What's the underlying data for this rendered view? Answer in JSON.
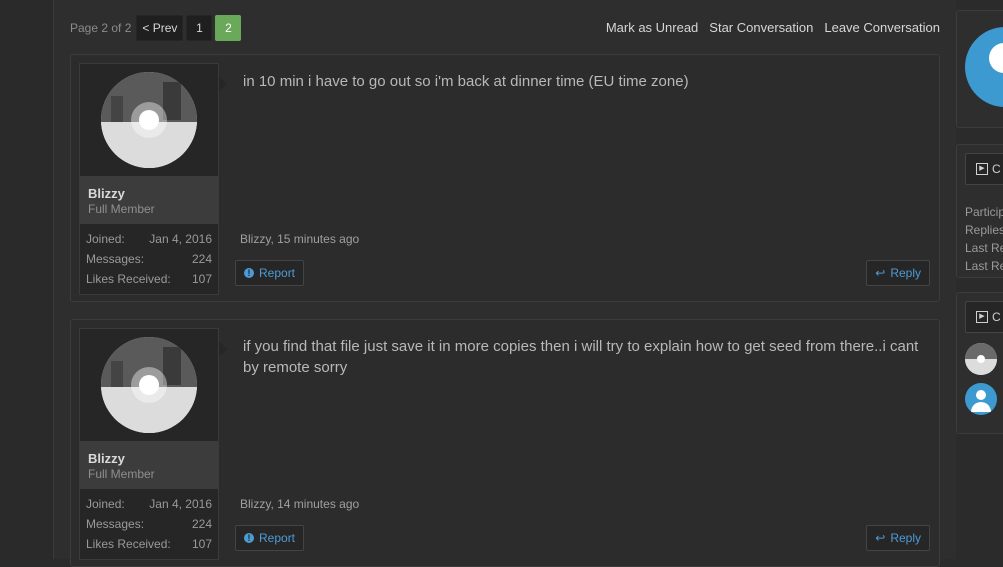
{
  "pagination": {
    "label": "Page 2 of 2",
    "prev": "< Prev",
    "pages": [
      "1",
      "2"
    ],
    "current": "2"
  },
  "conversation_actions": {
    "mark_unread": "Mark as Unread",
    "star": "Star Conversation",
    "leave": "Leave Conversation"
  },
  "posts": [
    {
      "author": "Blizzy",
      "user_title": "Full Member",
      "stats": [
        {
          "label": "Joined:",
          "value": "Jan 4, 2016"
        },
        {
          "label": "Messages:",
          "value": "224"
        },
        {
          "label": "Likes Received:",
          "value": "107"
        }
      ],
      "message": "in 10 min i have to go out so i'm back at dinner time (EU time zone)",
      "meta": "Blizzy, 15 minutes ago",
      "report_label": "Report",
      "reply_label": "Reply"
    },
    {
      "author": "Blizzy",
      "user_title": "Full Member",
      "stats": [
        {
          "label": "Joined:",
          "value": "Jan 4, 2016"
        },
        {
          "label": "Messages:",
          "value": "224"
        },
        {
          "label": "Likes Received:",
          "value": "107"
        }
      ],
      "message": "if you find that file just save it in more copies then i will try to explain how to get seed from there..i cant by remote sorry",
      "meta": "Blizzy, 14 minutes ago",
      "report_label": "Report",
      "reply_label": "Reply"
    }
  ],
  "sidebar": {
    "info_header": "C",
    "info_items": [
      "Particip",
      "Replies",
      "Last Re",
      "Last Re"
    ],
    "participants_header": "C"
  },
  "colors": {
    "accent_green": "#6aa85a",
    "link_blue": "#4d9bd6",
    "avatar_blue": "#3d9ad1"
  }
}
